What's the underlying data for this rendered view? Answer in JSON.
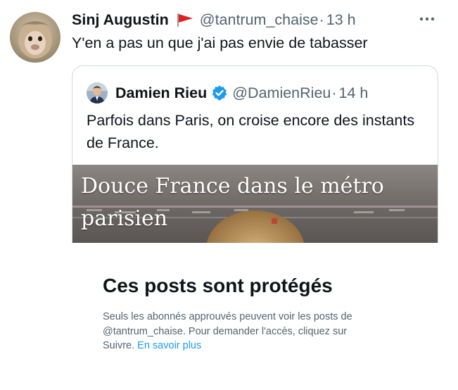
{
  "tweet": {
    "display_name": "Sinj Augustin",
    "handle": "@tantrum_chaise",
    "separator": "·",
    "time": "13 h",
    "text": "Y'en a pas un que j'ai pas envie de tabasser",
    "avatar_icon": "monkey-avatar",
    "flag_icon": "red-flag-icon",
    "more_icon": "more-dots-icon"
  },
  "quote": {
    "display_name": "Damien Rieu",
    "handle": "@DamienRieu",
    "separator": "·",
    "time": "14 h",
    "text": "Parfois dans Paris, on croise encore des instants de France.",
    "verified_icon": "verified-badge-icon",
    "media": {
      "caption_line1": "Douce France dans le métro",
      "caption_line2": "parisien"
    }
  },
  "protected": {
    "title": "Ces posts sont protégés",
    "body": "Seuls les abonnés approuvés peuvent voir les posts de @tantrum_chaise. Pour demander l'accès, cliquez sur Suivre.",
    "link": "En savoir plus"
  },
  "colors": {
    "text_primary": "#0f1419",
    "text_secondary": "#536471",
    "link": "#1d9bf0",
    "verified": "#1d9bf0",
    "border": "#cfd9de",
    "flag": "#e0211f"
  }
}
